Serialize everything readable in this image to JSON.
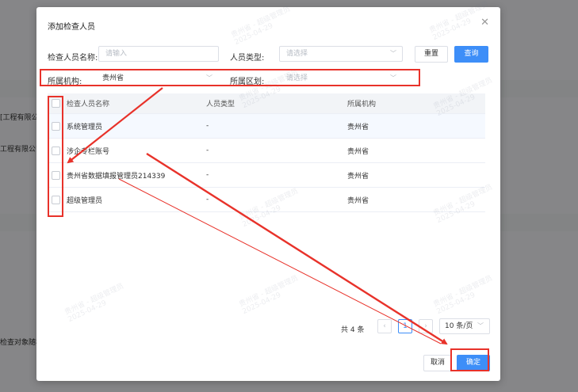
{
  "background": {
    "row_texts": [
      "[工程有限公",
      "工程有限公司",
      "检查对象随机"
    ]
  },
  "modal": {
    "title": "添加检查人员",
    "close_icon": "close-icon",
    "filters": {
      "name_label": "检查人员名称:",
      "name_placeholder": "请输入",
      "type_label": "人员类型:",
      "type_placeholder": "请选择",
      "org_label": "所属机构:",
      "org_value": "贵州省",
      "district_label": "所属区划:",
      "district_placeholder": "请选择"
    },
    "buttons": {
      "reset": "重置",
      "search": "查询",
      "cancel": "取消",
      "confirm": "确定"
    },
    "table": {
      "headers": {
        "name": "检查人员名称",
        "type": "人员类型",
        "org": "所属机构"
      },
      "rows": [
        {
          "name": "系统管理员",
          "type": "-",
          "org": "贵州省"
        },
        {
          "name": "涉企专栏账号",
          "type": "-",
          "org": "贵州省"
        },
        {
          "name": "贵州省数据填报管理员214339",
          "type": "-",
          "org": "贵州省"
        },
        {
          "name": "超级管理员",
          "type": "-",
          "org": "贵州省"
        }
      ]
    },
    "pagination": {
      "total": "共 4 条",
      "current_page": "1",
      "page_size": "10 条/页",
      "prev_icon": "chevron-left-icon",
      "next_icon": "chevron-right-icon"
    }
  },
  "watermark": {
    "line1": "贵州省 - 超级管理员",
    "line2": "2025-04-29"
  },
  "colors": {
    "primary": "#3d8ef8",
    "annotation": "#e8322a"
  }
}
